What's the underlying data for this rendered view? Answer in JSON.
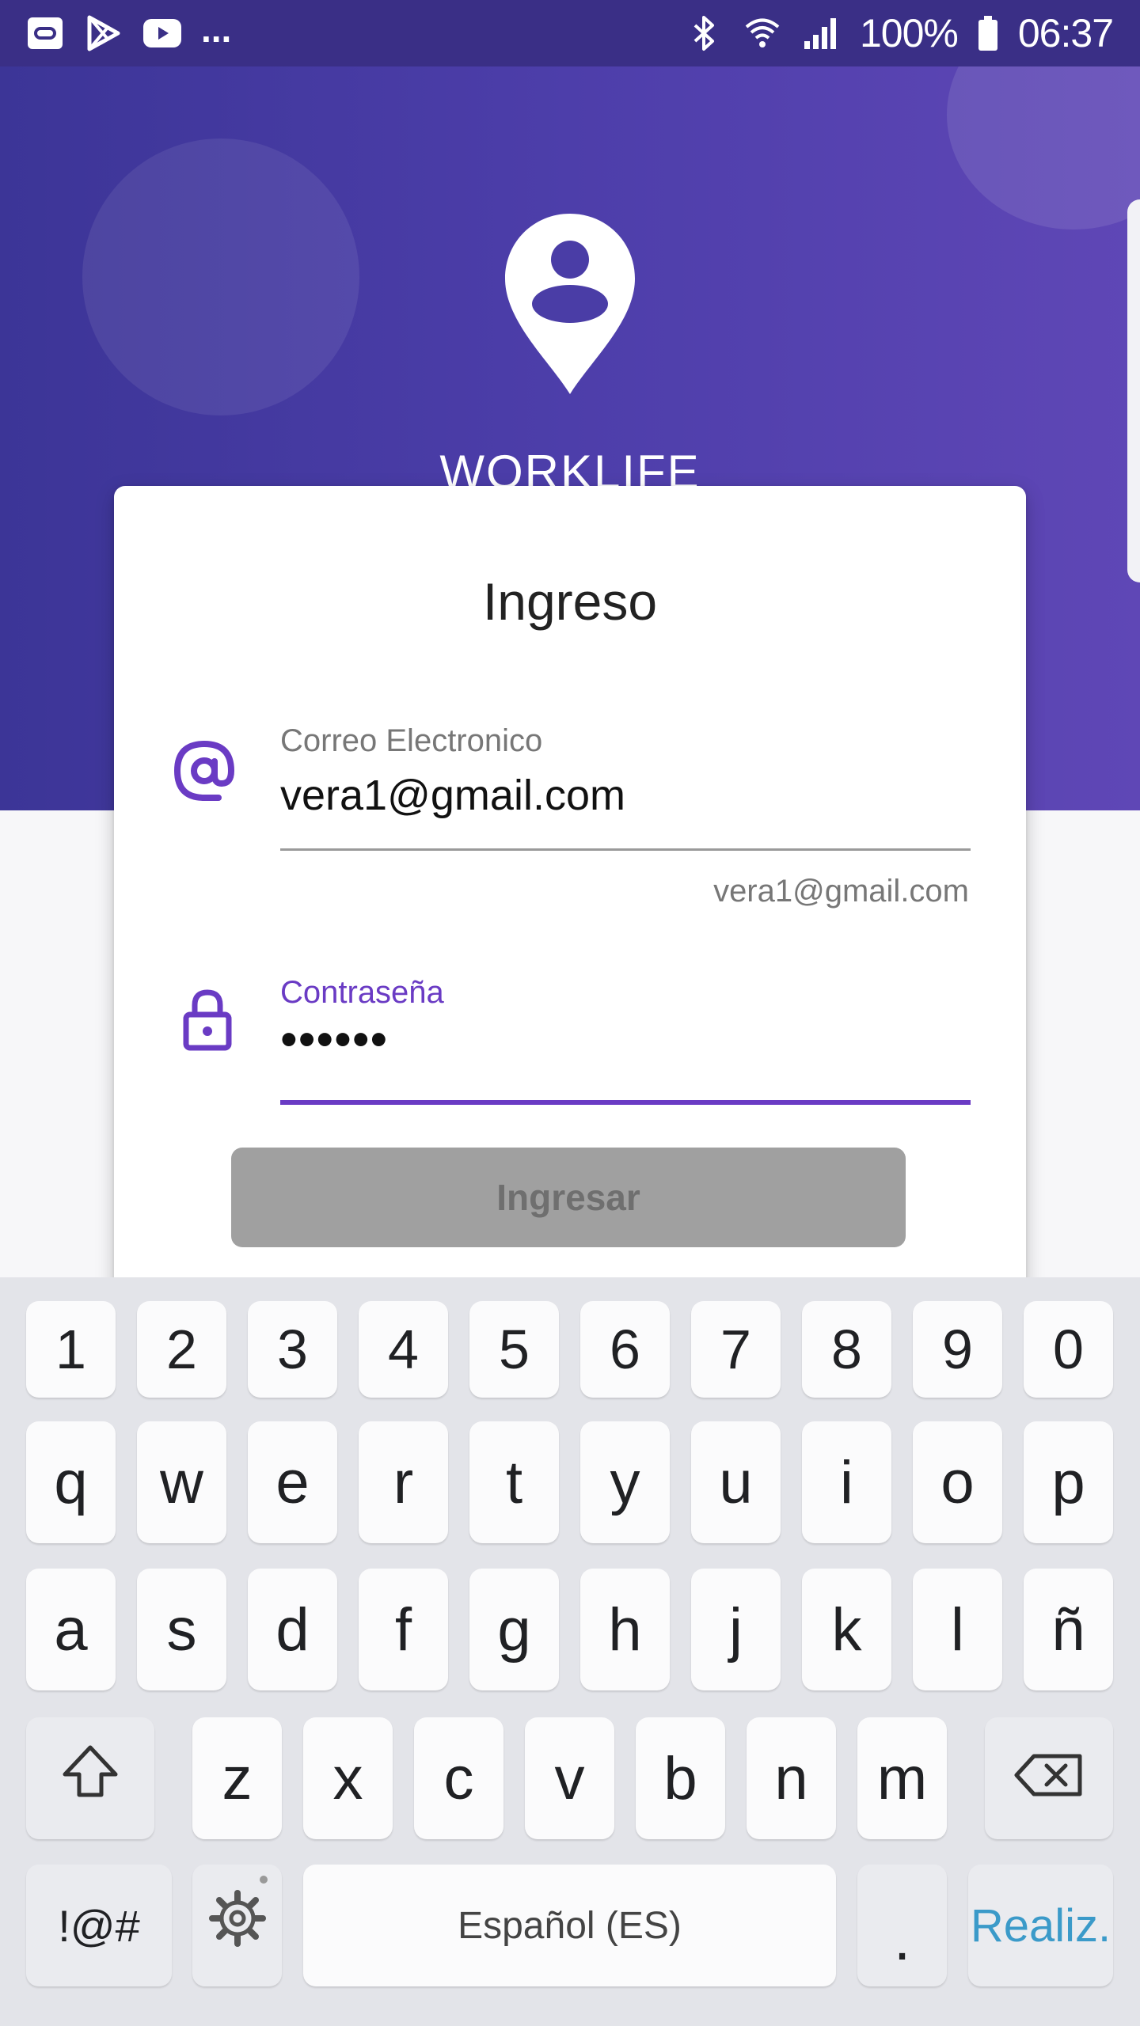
{
  "status_bar": {
    "notification_icons": [
      "tv-app-icon",
      "play-store-icon",
      "youtube-icon"
    ],
    "more": "...",
    "system_icons": [
      "bluetooth-icon",
      "wifi-icon",
      "signal-icon"
    ],
    "battery_percent": "100%",
    "time": "06:37"
  },
  "app": {
    "name": "WORKLIFE",
    "logo_icon": "person-pin-icon"
  },
  "login": {
    "title": "Ingreso",
    "email": {
      "icon": "at-sign-icon",
      "label": "Correo Electronico",
      "value": "vera1@gmail.com",
      "helper": "vera1@gmail.com"
    },
    "password": {
      "icon": "lock-icon",
      "label": "Contraseña",
      "value": "••••••"
    },
    "submit_label": "Ingresar"
  },
  "keyboard": {
    "number_row": [
      "1",
      "2",
      "3",
      "4",
      "5",
      "6",
      "7",
      "8",
      "9",
      "0"
    ],
    "row1": [
      "q",
      "w",
      "e",
      "r",
      "t",
      "y",
      "u",
      "i",
      "o",
      "p"
    ],
    "row2": [
      "a",
      "s",
      "d",
      "f",
      "g",
      "h",
      "j",
      "k",
      "l",
      "ñ"
    ],
    "row3": [
      "z",
      "x",
      "c",
      "v",
      "b",
      "n",
      "m"
    ],
    "symbols_label": "!@#",
    "space_label": "Español (ES)",
    "period_label": ".",
    "done_label": "Realiz."
  },
  "colors": {
    "accent": "#6a3bc4",
    "hero": "#4d3eaa",
    "status_bar": "#3a2f86",
    "button_disabled": "#a0a0a0",
    "done_key": "#3b9ac9"
  }
}
